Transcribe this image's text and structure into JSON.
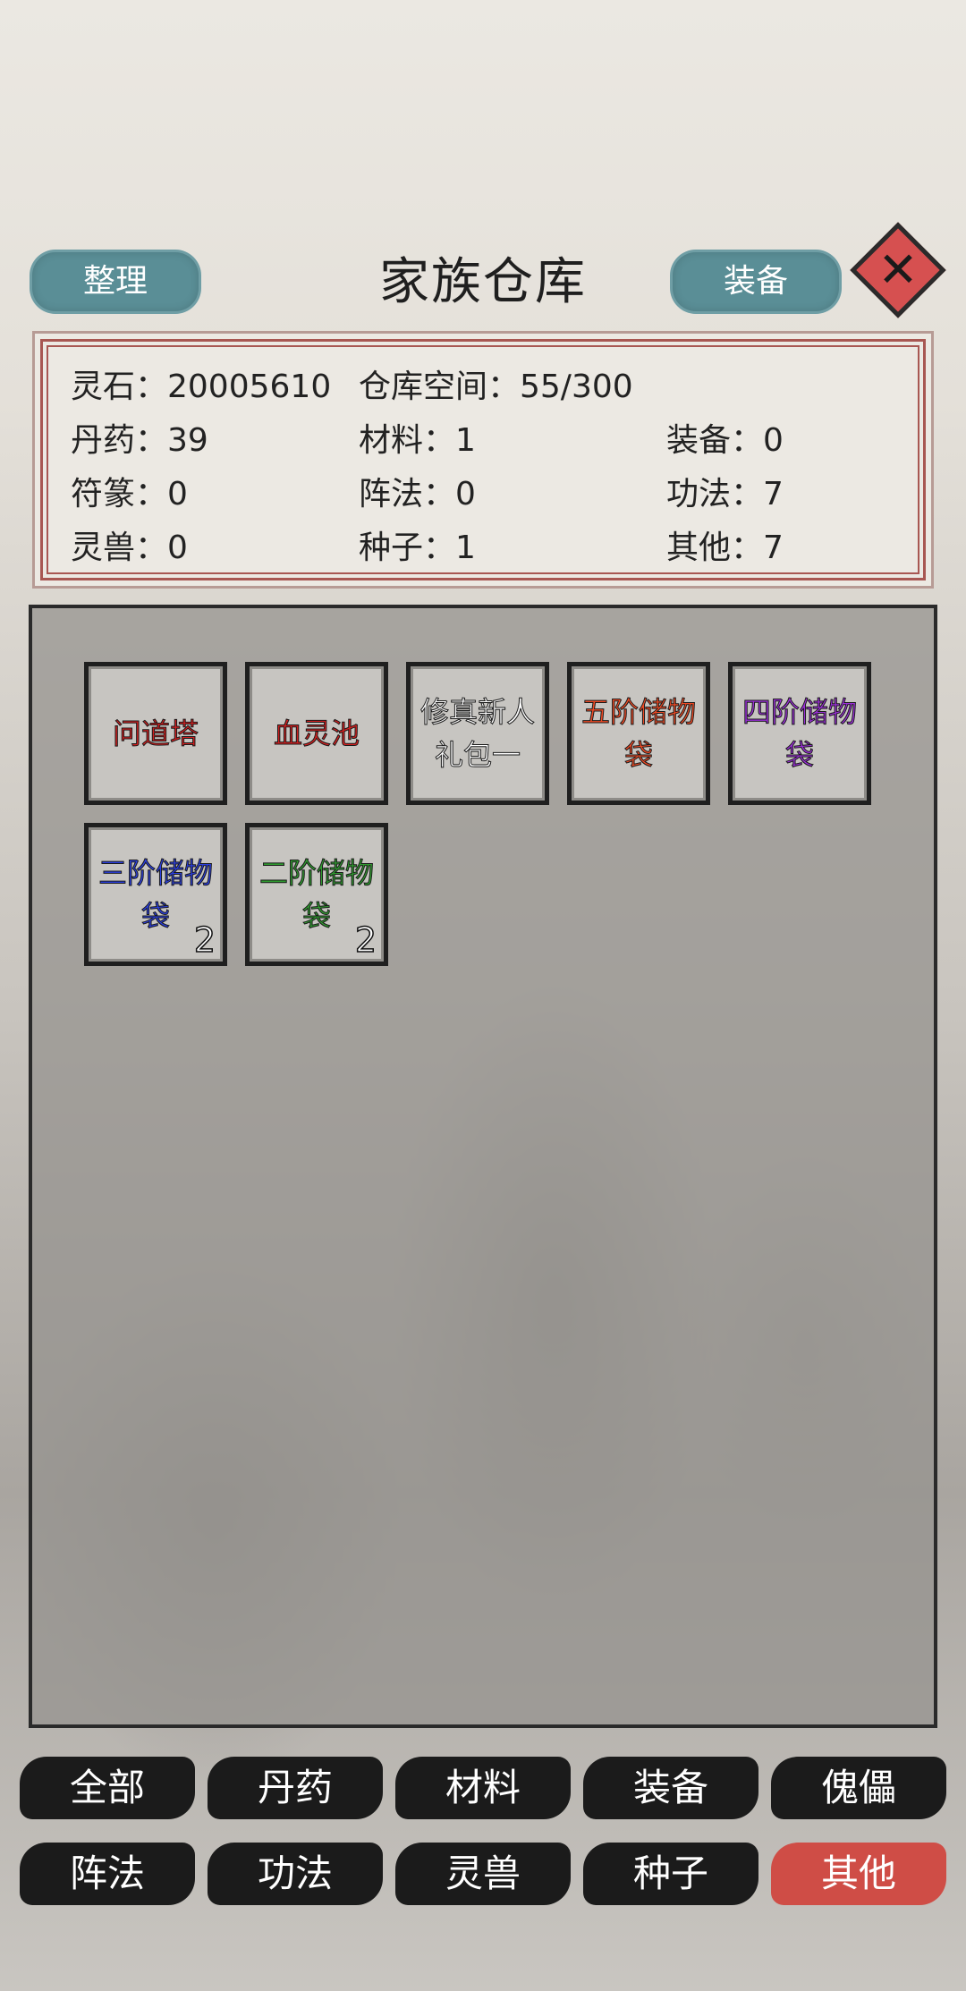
{
  "header": {
    "title": "家族仓库",
    "sort_label": "整理",
    "equip_label": "装备",
    "close_icon": "close-icon"
  },
  "info": {
    "spirit_stones": "灵石：20005610",
    "storage_space": "仓库空间：55/300",
    "pills": "丹药：39",
    "materials": "材料：1",
    "equipment": "装备：0",
    "talismans": "符篆：0",
    "formations": "阵法：0",
    "techniques": "功法：7",
    "spirit_beasts": "灵兽：0",
    "seeds": "种子：1",
    "others": "其他：7"
  },
  "items": [
    {
      "name": "问道塔",
      "color": "#d21f1f",
      "count": ""
    },
    {
      "name": "血灵池",
      "color": "#d21f1f",
      "count": ""
    },
    {
      "name": "修真新人礼包一",
      "color": "#ffffff",
      "count": ""
    },
    {
      "name": "五阶储物袋",
      "color": "#ef4a24",
      "count": ""
    },
    {
      "name": "四阶储物袋",
      "color": "#9b2fd8",
      "count": ""
    },
    {
      "name": "三阶储物袋",
      "color": "#2b3fe0",
      "count": "2"
    },
    {
      "name": "二阶储物袋",
      "color": "#2f9a2f",
      "count": "2"
    }
  ],
  "tabs": {
    "row1": [
      "全部",
      "丹药",
      "材料",
      "装备",
      "傀儡"
    ],
    "row2": [
      "阵法",
      "功法",
      "灵兽",
      "种子",
      "其他"
    ],
    "active": "其他"
  }
}
